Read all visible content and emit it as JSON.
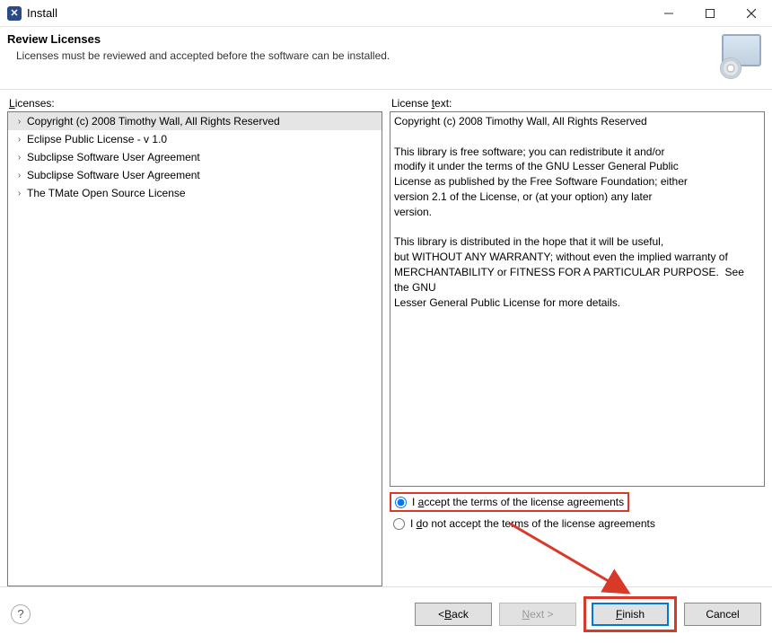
{
  "window": {
    "title": "Install"
  },
  "header": {
    "title": "Review Licenses",
    "description": "Licenses must be reviewed and accepted before the software can be installed."
  },
  "panels": {
    "left_label_pre": "",
    "left_label_u": "L",
    "left_label_post": "icenses:",
    "right_label_pre": "License ",
    "right_label_u": "t",
    "right_label_post": "ext:"
  },
  "licenses": [
    {
      "label": "Copyright (c) 2008 Timothy Wall, All Rights Reserved",
      "selected": true
    },
    {
      "label": "Eclipse Public License - v 1.0",
      "selected": false
    },
    {
      "label": "Subclipse Software User Agreement",
      "selected": false
    },
    {
      "label": "Subclipse Software User Agreement",
      "selected": false
    },
    {
      "label": "The TMate Open Source License",
      "selected": false
    }
  ],
  "license_text": "Copyright (c) 2008 Timothy Wall, All Rights Reserved\n\nThis library is free software; you can redistribute it and/or\nmodify it under the terms of the GNU Lesser General Public\nLicense as published by the Free Software Foundation; either\nversion 2.1 of the License, or (at your option) any later\nversion.\n\nThis library is distributed in the hope that it will be useful,\nbut WITHOUT ANY WARRANTY; without even the implied warranty of\nMERCHANTABILITY or FITNESS FOR A PARTICULAR PURPOSE.  See the GNU\nLesser General Public License for more details.",
  "radios": {
    "accept_pre": "I ",
    "accept_u": "a",
    "accept_post": "ccept the terms of the license agreements",
    "decline_pre": "I ",
    "decline_u": "d",
    "decline_post": "o not accept the terms of the license agreements",
    "selected": "accept"
  },
  "buttons": {
    "back_pre": "< ",
    "back_u": "B",
    "back_post": "ack",
    "next_u": "N",
    "next_post": "ext >",
    "finish_u": "F",
    "finish_post": "inish",
    "cancel": "Cancel"
  },
  "annotation": {
    "highlight_accept": true,
    "highlight_finish": true,
    "arrow": true
  }
}
